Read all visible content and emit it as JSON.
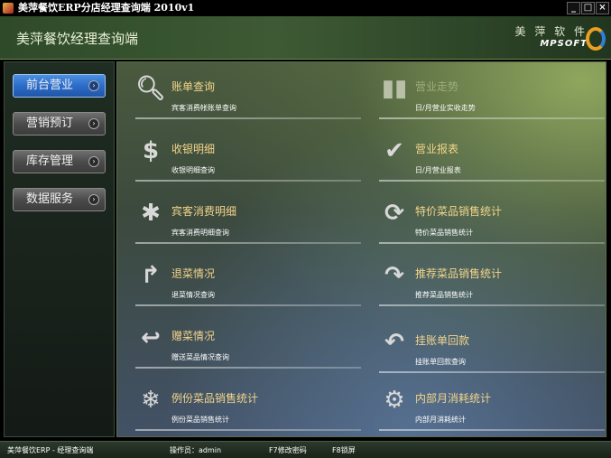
{
  "window": {
    "title": "美萍餐饮ERP分店经理查询端 2010v1",
    "controls": [
      "_",
      "□",
      "×"
    ]
  },
  "header": {
    "title": "美萍餐饮经理查询端",
    "brand_cn": "美 萍 软 件",
    "brand_en": "MPSOFT"
  },
  "sidebar": {
    "items": [
      {
        "label": "前台营业",
        "active": true
      },
      {
        "label": "营销预订",
        "active": false
      },
      {
        "label": "库存管理",
        "active": false
      },
      {
        "label": "数据服务",
        "active": false
      }
    ]
  },
  "main": {
    "items": [
      {
        "title": "账单查询",
        "subtitle": "宾客消费帐账单查询",
        "icon": "search-icon"
      },
      {
        "title": "营业走势",
        "subtitle": "日/月营业实收走势",
        "icon": "bar-chart-icon"
      },
      {
        "title": "收银明细",
        "subtitle": "收银明细查询",
        "icon": "dollar-icon"
      },
      {
        "title": "营业报表",
        "subtitle": "日/月营业报表",
        "icon": "checkmark-icon"
      },
      {
        "title": "宾客消费明细",
        "subtitle": "宾客消费明细查询",
        "icon": "asterisk-icon"
      },
      {
        "title": "特价菜品销售统计",
        "subtitle": "特价菜品销售统计",
        "icon": "refresh-icon"
      },
      {
        "title": "退菜情况",
        "subtitle": "退菜情况查询",
        "icon": "return-arrow-icon"
      },
      {
        "title": "推荐菜品销售统计",
        "subtitle": "推荐菜品销售统计",
        "icon": "redo-arrow-icon"
      },
      {
        "title": "赠菜情况",
        "subtitle": "赠送菜品情况查询",
        "icon": "undo-down-icon"
      },
      {
        "title": "挂账单回款",
        "subtitle": "挂账单回款查询",
        "icon": "curved-back-icon"
      },
      {
        "title": "例份菜品销售统计",
        "subtitle": "例份菜品销售统计",
        "icon": "snowflake-icon"
      },
      {
        "title": "内部月消耗统计",
        "subtitle": "内部月消耗统计",
        "icon": "gear-icon"
      }
    ]
  },
  "statusbar": {
    "app": "美萍餐饮ERP - 经理查询端",
    "operator": "操作员：admin",
    "f7": "F7修改密码",
    "f8": "F8锁屏"
  }
}
